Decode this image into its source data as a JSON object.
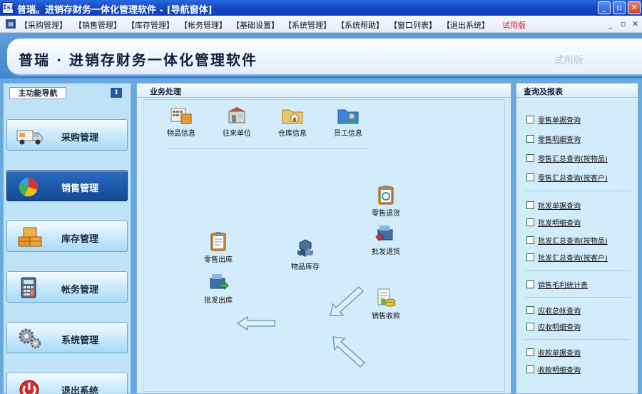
{
  "window": {
    "title": "普瑞。进销存财务一体化管理软件 - [导航窗体]",
    "app_icon_text": "Isi",
    "controls": [
      "_",
      "▫",
      "✕"
    ]
  },
  "menubar": {
    "items": [
      "【采购管理】",
      "【销售管理】",
      "【库存管理】",
      "【帐务管理】",
      "【基础设置】",
      "【系统管理】",
      "【系统帮助】",
      "【窗口列表】",
      "【退出系统】"
    ],
    "trial": "试用版",
    "mdi_controls": [
      "_",
      "▫",
      "✕"
    ]
  },
  "banner": {
    "title": "普瑞 · 进销存财务一体化管理软件",
    "trial": "试用版"
  },
  "leftnav": {
    "header": "主功能导航",
    "items": [
      {
        "label": "采购管理",
        "icon": "truck-icon",
        "active": false
      },
      {
        "label": "销售管理",
        "icon": "pie-chart-icon",
        "active": true
      },
      {
        "label": "库存管理",
        "icon": "boxes-icon",
        "active": false
      },
      {
        "label": "帐务管理",
        "icon": "calculator-icon",
        "active": false
      },
      {
        "label": "系统管理",
        "icon": "gears-icon",
        "active": false
      },
      {
        "label": "退出系统",
        "icon": "power-icon",
        "active": false
      }
    ]
  },
  "center": {
    "header": "业务处理",
    "tools": [
      "物品信息",
      "往来单位",
      "仓库信息",
      "员工信息"
    ],
    "flow": {
      "retail_out": "零售出库",
      "wholesale_out": "批发出库",
      "inventory": "物品库存",
      "retail_return": "零售退货",
      "wholesale_return": "批发退货",
      "sales_receipt": "销售收款"
    }
  },
  "right": {
    "header": "查询及报表",
    "groups": [
      [
        "零售单据查询",
        "零售明细查询",
        "零售汇总查询(按物品)",
        "零售汇总查询(按客户)"
      ],
      [
        "批发单据查询",
        "批发明细查询",
        "批发汇总查询(按物品)",
        "批发汇总查询(按客户)"
      ],
      [
        "销售毛利统计表"
      ],
      [
        "应收总帐查询",
        "应收明细查询"
      ],
      [
        "收款单据查询",
        "收款明细查询"
      ]
    ]
  },
  "colors": {
    "titlebar": "#1547c4",
    "accent_active": "#1b58a8",
    "panel_bg": "#d3ecfb",
    "trial_red": "#c02020"
  }
}
